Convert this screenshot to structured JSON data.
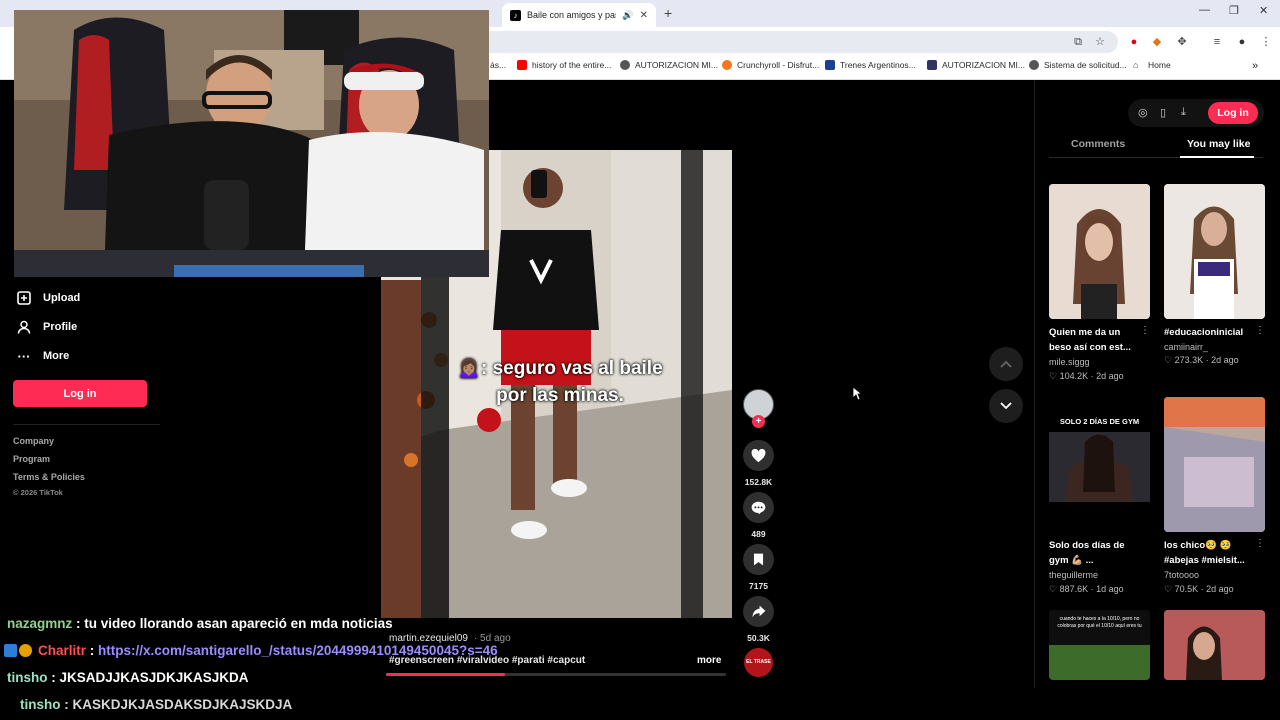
{
  "browser": {
    "tab_title": "Baile con amigos y pasos re",
    "new_tab_label": "+",
    "bookmarks": [
      {
        "label": "history of the entire...",
        "icon": "youtube-icon",
        "color": "#ff0000"
      },
      {
        "label": "AUTORIZACION MI...",
        "icon": "globe-icon",
        "color": "#555555"
      },
      {
        "label": "Crunchyroll - Disfrut...",
        "icon": "crunchyroll-icon",
        "color": "#f47521"
      },
      {
        "label": "Trenes Argentinos...",
        "icon": "site-icon",
        "color": "#1d3f8f"
      },
      {
        "label": "AUTORIZACION MI...",
        "icon": "site-icon",
        "color": "#333366"
      },
      {
        "label": "Sistema de solicitud...",
        "icon": "globe-icon",
        "color": "#555555"
      },
      {
        "label": "Home",
        "icon": "home-icon",
        "color": "#444444"
      }
    ],
    "bookmark_prefix": "ás...",
    "more_bookmarks": "»"
  },
  "sidebar": {
    "items": [
      {
        "label": "Upload",
        "icon": "upload-icon"
      },
      {
        "label": "Profile",
        "icon": "profile-icon"
      },
      {
        "label": "More",
        "icon": "more-icon"
      }
    ],
    "login_label": "Log in",
    "footer_links": [
      "Company",
      "Program",
      "Terms & Policies"
    ],
    "copyright": "© 2026 TikTok"
  },
  "video": {
    "caption_line1": "🙍🏽‍♀️: seguro vas al baile",
    "caption_line2": "por las minas.",
    "author": "martin.ezequiel09",
    "posted": "· 5d ago",
    "tags": "#greenscreen #viralvideo #parati #capcut",
    "more_label": "more",
    "progress": 0.35,
    "likes": "152.8K",
    "comments": "489",
    "saves": "7175",
    "shares": "50.3K",
    "music_label": "EL TRASE"
  },
  "right_panel": {
    "login_label": "Log in",
    "tabs": [
      {
        "label": "Comments",
        "active": false
      },
      {
        "label": "You may like",
        "active": true
      }
    ],
    "cards": [
      {
        "title": "Quien me da un beso así con est...",
        "author": "mile.siggg",
        "likes": "104.2K",
        "ago": "2d ago",
        "thumb_color": "#d9c2b5"
      },
      {
        "title": "#educacioninicial",
        "author": "camiinairr_",
        "likes": "273.3K",
        "ago": "2d ago",
        "thumb_color": "#cbb3a6"
      },
      {
        "title": "Solo dos días de gym 💪🏼 ...",
        "author": "theguillerme",
        "likes": "887.6K",
        "ago": "1d ago",
        "thumb_color": "#1a1a1a",
        "overlay": "SOLO 2 DÍAS DE GYM"
      },
      {
        "title": "los chico🥺 🥺 #abejas #mielsit...",
        "author": "7totoooo",
        "likes": "70.5K",
        "ago": "2d ago",
        "thumb_color": "#b8a49c"
      },
      {
        "overlay": "cuando te haces a la 10/10, pero no colobras por qué el 10/10 aquí eres tu",
        "thumb_color": "#2c3a22"
      },
      {
        "thumb_color": "#a85a55"
      }
    ]
  },
  "chat": [
    {
      "user": "nazagmnz",
      "user_color": "#8fd18f",
      "text": "tu video llorando asan apareció en mda noticias",
      "link": false
    },
    {
      "user": "Charlitr",
      "user_color": "#ff4f4f",
      "text": "https://x.com/santigarello_/status/2044999410149450045?s=46",
      "link": true,
      "badges": true
    },
    {
      "user": "tinsho",
      "user_color": "#9de0c2",
      "text": "JKSADJJKASJDKJKASJKDA",
      "link": false
    },
    {
      "user": "tinsho",
      "user_color": "#9de0c2",
      "text": "KASKDJKJASDAKSDJKAJSKDJA",
      "link": false
    }
  ],
  "colors": {
    "accent": "#fe2c55"
  }
}
